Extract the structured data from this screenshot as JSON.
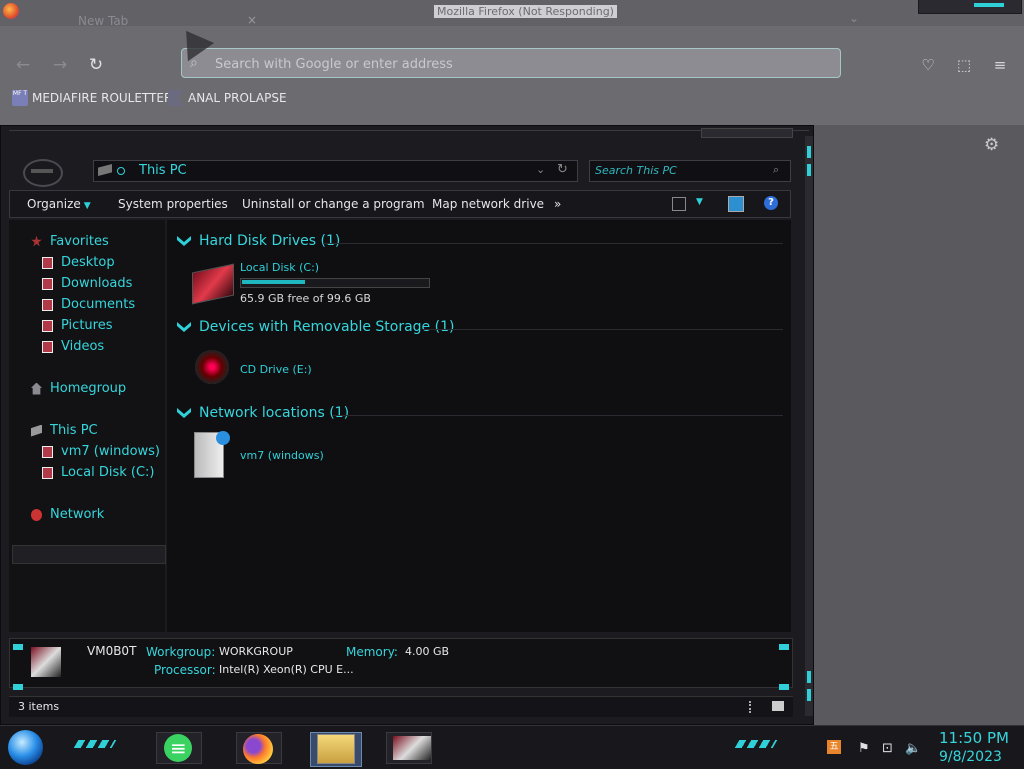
{
  "firefox": {
    "window_title": "Mozilla Firefox (Not Responding)",
    "tab_label": "New Tab",
    "tab_close": "×",
    "tabs_overflow": "⌄",
    "url_placeholder": "Search with Google or enter address",
    "nav": {
      "back": "←",
      "forward": "→",
      "reload": "↻"
    },
    "toolbar_icons": {
      "pocket": "♡",
      "extensions": "⬚",
      "menu": "≡"
    },
    "bookmarks": [
      {
        "label": "MEDIAFIRE ROULETTER",
        "icon_text": "MF T"
      },
      {
        "label": "ANAL PROLAPSE"
      }
    ],
    "settings_icon": "⚙"
  },
  "explorer": {
    "address": "This PC",
    "address_controls": {
      "dropdown": "⌄",
      "refresh": "↻"
    },
    "search_placeholder": "Search This PC",
    "search_icon": "⌕",
    "toolbar": {
      "organize": "Organize",
      "system_properties": "System properties",
      "uninstall": "Uninstall or change a program",
      "map_drive": "Map network drive",
      "more": "»",
      "help": "?"
    },
    "nav": {
      "favorites": "Favorites",
      "desktop": "Desktop",
      "downloads": "Downloads",
      "documents": "Documents",
      "pictures": "Pictures",
      "videos": "Videos",
      "homegroup": "Homegroup",
      "this_pc": "This PC",
      "vm7": "vm7 (windows)",
      "local_disk": "Local Disk (C:)",
      "network": "Network"
    },
    "groups": {
      "hdd_header": "Hard Disk Drives (1)",
      "removable_header": "Devices with Removable Storage (1)",
      "network_header": "Network locations (1)"
    },
    "items": {
      "local_disk_label": "Local Disk (C:)",
      "local_disk_free": "65.9 GB free of 99.6 GB",
      "local_disk_used_fraction": 0.338,
      "cd_label": "CD Drive (E:)",
      "vm7_label": "vm7 (windows)"
    },
    "details": {
      "name": "VM0B0T",
      "workgroup_label": "Workgroup:",
      "workgroup_value": "WORKGROUP",
      "memory_label": "Memory:",
      "memory_value": "4.00 GB",
      "processor_label": "Processor:",
      "processor_value": "Intel(R) Xeon(R) CPU E..."
    },
    "status": {
      "count": "3 items"
    }
  },
  "taskbar": {
    "tray": {
      "ime": "五",
      "flag": "⚑",
      "network": "⊡",
      "volume": "🔈"
    },
    "time": "11:50 PM",
    "date": "9/8/2023"
  },
  "colors": {
    "accent": "#35d6dc",
    "window_bg": "#1c1c20",
    "chrome_bg": "#6b6b70"
  }
}
